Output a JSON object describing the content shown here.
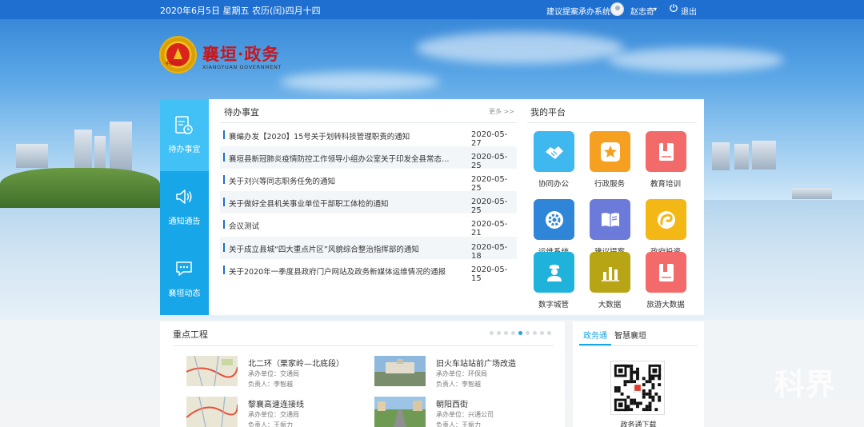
{
  "topbar": {
    "date": "2020年6月5日 星期五 农历(闰)四月十四",
    "system_link": "建议提案承办系统",
    "user_name": "赵志奇",
    "caret": "▾",
    "logout": "退出"
  },
  "logo": {
    "emblem_text": "中国长治",
    "title": "襄垣·政务",
    "subtitle": "XIANGYUAN GOVERNMENT"
  },
  "leftnav": {
    "items": [
      {
        "label": "待办事宜",
        "icon": "document-clock-icon",
        "active": true
      },
      {
        "label": "通知通告",
        "icon": "speaker-icon",
        "active": false
      },
      {
        "label": "襄垣动态",
        "icon": "chat-bubble-icon",
        "active": false
      }
    ]
  },
  "todo": {
    "title": "待办事宜",
    "more": "更多 >>",
    "items": [
      {
        "text": "襄编办发【2020】15号关于划转科技管理职责的通知",
        "date": "2020-05-27"
      },
      {
        "text": "襄垣县新冠肺炎疫情防控工作领导小组办公室关于印发全县常态化疫...",
        "date": "2020-05-25"
      },
      {
        "text": "关于刘兴等同志职务任免的通知",
        "date": "2020-05-25"
      },
      {
        "text": "关于做好全县机关事业单位干部职工体检的通知",
        "date": "2020-05-25"
      },
      {
        "text": "会议测试",
        "date": "2020-05-21"
      },
      {
        "text": "关于成立县城“四大重点片区”风貌综合整治指挥部的通知",
        "date": "2020-05-18"
      },
      {
        "text": "关于2020年一季度县政府门户网站及政务新媒体运维情况的通报",
        "date": "2020-05-15"
      }
    ]
  },
  "platform": {
    "title": "我的平台",
    "items": [
      {
        "label": "协同办公",
        "icon": "handshake-icon",
        "color": "#3fb7ef"
      },
      {
        "label": "行政服务",
        "icon": "star-icon",
        "color": "#f6a022"
      },
      {
        "label": "教育培训",
        "icon": "book-icon",
        "color": "#f26a6a"
      },
      {
        "label": "运维系统",
        "icon": "gear-icon",
        "color": "#2f86d8"
      },
      {
        "label": "建议提案",
        "icon": "open-book-icon",
        "color": "#6c7ad9"
      },
      {
        "label": "政府投资",
        "icon": "swirl-icon",
        "color": "#f3b716"
      },
      {
        "label": "数字城管",
        "icon": "officer-icon",
        "color": "#1fb3dc"
      },
      {
        "label": "大数据",
        "icon": "bar-chart-icon",
        "color": "#b8a516"
      },
      {
        "label": "旅游大数据",
        "icon": "book-icon",
        "color": "#f26a6a"
      }
    ]
  },
  "key_projects": {
    "title": "重点工程",
    "slides_total": 9,
    "slide_active": 4,
    "items": [
      {
        "name": "北二环（栗家岭—北底段）",
        "unit": "承办单位：交通局",
        "owner": "负责人：李智越",
        "thumb": "map"
      },
      {
        "name": "旧火车站站前广场改造",
        "unit": "承办单位：环保局",
        "owner": "负责人：李智越",
        "thumb": "plaza"
      },
      {
        "name": "黎襄高速连接线",
        "unit": "承办单位：交通局",
        "owner": "负责人：王振力",
        "thumb": "map"
      },
      {
        "name": "朝阳西街",
        "unit": "承办单位：兴通公司",
        "owner": "负责人：王振力",
        "thumb": "street"
      }
    ]
  },
  "gov": {
    "tabs": [
      {
        "label": "政务通",
        "active": true
      },
      {
        "label": "智慧襄垣",
        "active": false
      }
    ],
    "qr_label": "政务通下载"
  },
  "watermark": "科界",
  "colors": {
    "topbar": "#1e6fcf",
    "nav": "#17a6e8",
    "nav_active": "#41c1f6",
    "logo_red": "#c8161d"
  }
}
